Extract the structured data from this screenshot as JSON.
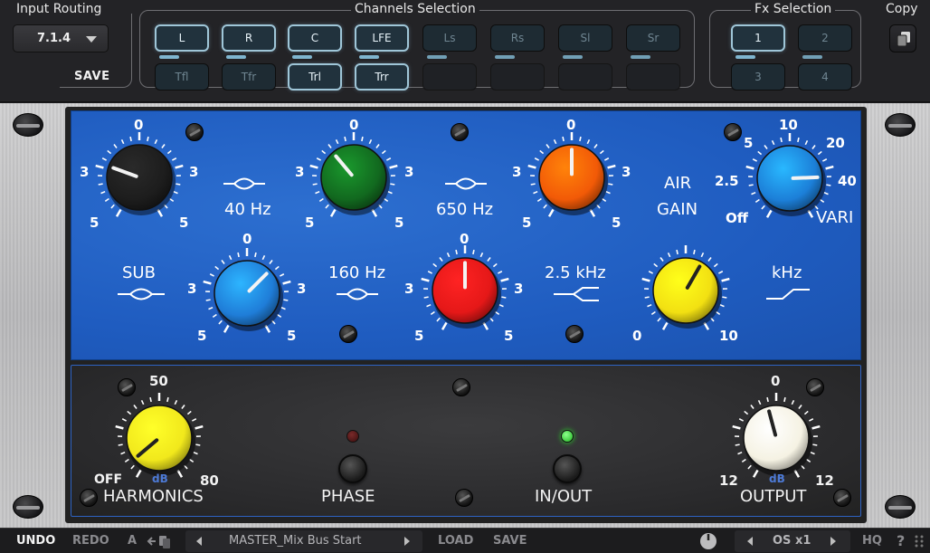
{
  "top": {
    "input_routing": {
      "title": "Input Routing",
      "value": "7.1.4",
      "save": "SAVE"
    },
    "channels": {
      "title": "Channels Selection",
      "row1": [
        {
          "label": "L",
          "on": true
        },
        {
          "label": "R",
          "on": true
        },
        {
          "label": "C",
          "on": true
        },
        {
          "label": "LFE",
          "on": true
        },
        {
          "label": "Ls",
          "on": false
        },
        {
          "label": "Rs",
          "on": false
        },
        {
          "label": "Sl",
          "on": false
        },
        {
          "label": "Sr",
          "on": false
        }
      ],
      "row2": [
        {
          "label": "Tfl",
          "on": false
        },
        {
          "label": "Tfr",
          "on": false
        },
        {
          "label": "Trl",
          "on": true
        },
        {
          "label": "Trr",
          "on": true
        },
        {
          "label": "",
          "on": false
        },
        {
          "label": "",
          "on": false
        },
        {
          "label": "",
          "on": false
        },
        {
          "label": "",
          "on": false
        }
      ]
    },
    "fx": {
      "title": "Fx Selection",
      "items": [
        {
          "label": "1",
          "on": true
        },
        {
          "label": "2",
          "on": false
        },
        {
          "label": "3",
          "on": false
        },
        {
          "label": "4",
          "on": false
        }
      ]
    },
    "copy": {
      "title": "Copy",
      "icon": "copy-icon"
    }
  },
  "eq": {
    "upper": [
      {
        "name": "low-band-gain",
        "color": "#1d1d1d",
        "ticks": [
          "0",
          "3",
          "3",
          "5",
          "5"
        ]
      },
      {
        "name": "low-mid-gain",
        "color": "#12691f",
        "ticks": [
          "0",
          "3",
          "3",
          "5",
          "5"
        ]
      },
      {
        "name": "high-mid-gain",
        "color": "#f25a07",
        "ticks": [
          "0",
          "3",
          "3",
          "5",
          "5"
        ]
      }
    ],
    "upper_freq_labels": [
      "40 Hz",
      "650 Hz"
    ],
    "air": {
      "label1": "AIR",
      "label2": "GAIN",
      "color": "#1c7fd8",
      "ticks": [
        "10",
        "5",
        "20",
        "2.5",
        "40",
        "Off"
      ],
      "vari": "VARI"
    },
    "lower": [
      {
        "name": "sub-freq",
        "color": "#1f7dd8",
        "ticks": [
          "0",
          "3",
          "3",
          "5",
          "5"
        ]
      },
      {
        "name": "mid-freq",
        "color": "#e51818",
        "ticks": [
          "0",
          "3",
          "3",
          "5",
          "5"
        ]
      },
      {
        "name": "air-freq",
        "color": "#f2e012",
        "ticks": [
          "0",
          "10"
        ]
      }
    ],
    "lower_labels": [
      "SUB",
      "160 Hz",
      "2.5 kHz",
      "kHz"
    ]
  },
  "bottom_section": {
    "harmonics": {
      "label": "HARMONICS",
      "top": "50",
      "min": "OFF",
      "max": "80",
      "unit": "dB",
      "color": "#f1e81c"
    },
    "phase": {
      "label": "PHASE",
      "led": "#5a1c1c"
    },
    "inout": {
      "label": "IN/OUT",
      "led": "#2bd62b"
    },
    "output": {
      "label": "OUTPUT",
      "top": "0",
      "min": "12",
      "max": "12",
      "unit": "dB",
      "color": "#f5f2e3"
    }
  },
  "footer": {
    "undo": "UNDO",
    "redo": "REDO",
    "ab": "A",
    "preset": "MASTER_Mix Bus Start",
    "load": "LOAD",
    "save": "SAVE",
    "os": "OS x1",
    "hq": "HQ",
    "help": "?"
  },
  "colors": {
    "accent": "#9fc6d8",
    "panel_blue": "#2262c4",
    "led_on": "#2bd62b"
  }
}
